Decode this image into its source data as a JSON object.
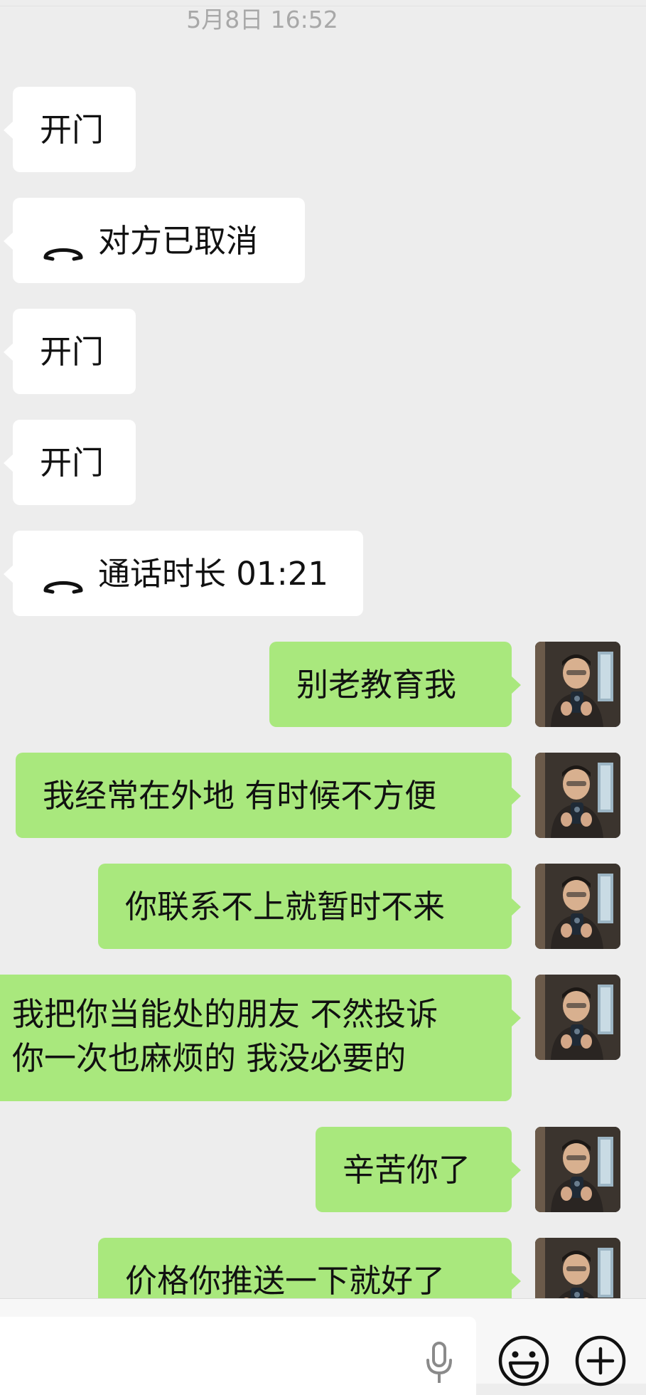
{
  "timestamp": "5月8日 16:52",
  "messages": [
    {
      "side": "in",
      "text": "开门"
    },
    {
      "side": "in",
      "type": "call",
      "icon": "phone-hangup-icon",
      "text": "对方已取消"
    },
    {
      "side": "in",
      "text": "开门"
    },
    {
      "side": "in",
      "text": "开门"
    },
    {
      "side": "in",
      "type": "call",
      "icon": "phone-hangup-icon",
      "text": "通话时长 01:21"
    },
    {
      "side": "out",
      "text": "别老教育我"
    },
    {
      "side": "out",
      "text": "我经常在外地 有时候不方便"
    },
    {
      "side": "out",
      "text": "你联系不上就暂时不来"
    },
    {
      "side": "out",
      "line1": "我把你当能处的朋友 不然投诉",
      "line2": "你一次也麻烦的 我没必要的"
    },
    {
      "side": "out",
      "text": "辛苦你了"
    },
    {
      "side": "out",
      "text": "价格你推送一下就好了"
    }
  ],
  "input_bar": {
    "text_value": "",
    "mic_icon": "microphone-icon",
    "emoji_icon": "emoji-smile-icon",
    "plus_icon": "plus-circle-icon"
  },
  "colors": {
    "background": "#ededed",
    "incoming_bubble": "#ffffff",
    "outgoing_bubble": "#a9e87d",
    "timestamp": "#a8a8a8"
  }
}
